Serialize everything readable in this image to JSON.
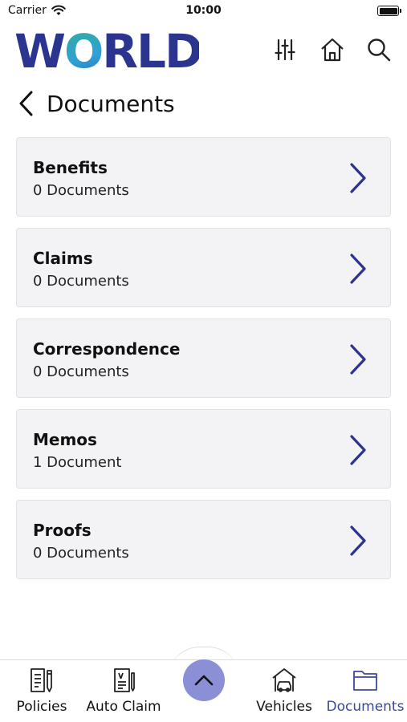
{
  "status_bar": {
    "carrier": "Carrier",
    "time": "10:00"
  },
  "header": {
    "logo_text": "WORLD",
    "icons": [
      "sliders-icon",
      "home-icon",
      "search-icon"
    ],
    "brand_color": "#2b3590"
  },
  "page": {
    "title": "Documents"
  },
  "documents": [
    {
      "name": "Benefits",
      "count": "0 Documents"
    },
    {
      "name": "Claims",
      "count": "0 Documents"
    },
    {
      "name": "Correspondence",
      "count": "0 Documents"
    },
    {
      "name": "Memos",
      "count": "1 Document"
    },
    {
      "name": "Proofs",
      "count": "0 Documents"
    }
  ],
  "tab_bar": {
    "tabs": [
      {
        "label": "Policies",
        "icon": "policies-icon"
      },
      {
        "label": "Auto Claim",
        "icon": "auto-claim-icon"
      },
      {
        "label": "Vehicles",
        "icon": "vehicles-icon"
      },
      {
        "label": "Documents",
        "icon": "documents-folder-icon",
        "active": true
      }
    ],
    "center_button_icon": "chevron-up-icon",
    "active_color": "#3a4a9a",
    "center_button_color": "#8b8fd6"
  }
}
